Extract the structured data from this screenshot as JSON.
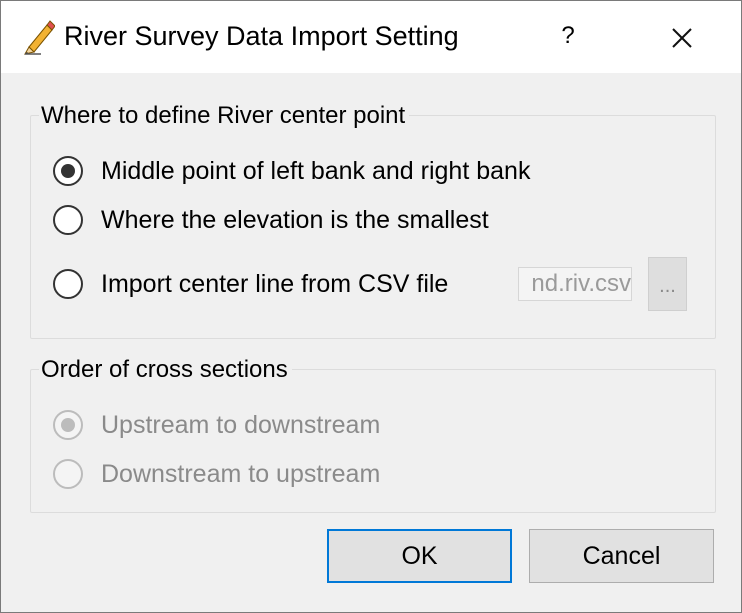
{
  "window": {
    "title": "River Survey Data Import Setting",
    "help_label": "?",
    "icons": {
      "app": "pencil-icon",
      "close": "close-icon"
    }
  },
  "center_point": {
    "title": "Where to define River center point",
    "options": [
      {
        "label": "Middle point of left bank and right bank",
        "checked": true
      },
      {
        "label": "Where the elevation is the smallest",
        "checked": false
      },
      {
        "label": "Import center line from CSV file",
        "checked": false
      }
    ],
    "csv_value": "nd.riv.csv",
    "browse_label": "..."
  },
  "order": {
    "title": "Order of cross sections",
    "enabled": false,
    "options": [
      {
        "label": "Upstream to downstream",
        "checked": true
      },
      {
        "label": "Downstream to upstream",
        "checked": false
      }
    ]
  },
  "buttons": {
    "ok": "OK",
    "cancel": "Cancel"
  },
  "colors": {
    "accent": "#0078d7",
    "background": "#f0f0f0",
    "disabled_text": "#8a8a8a"
  }
}
